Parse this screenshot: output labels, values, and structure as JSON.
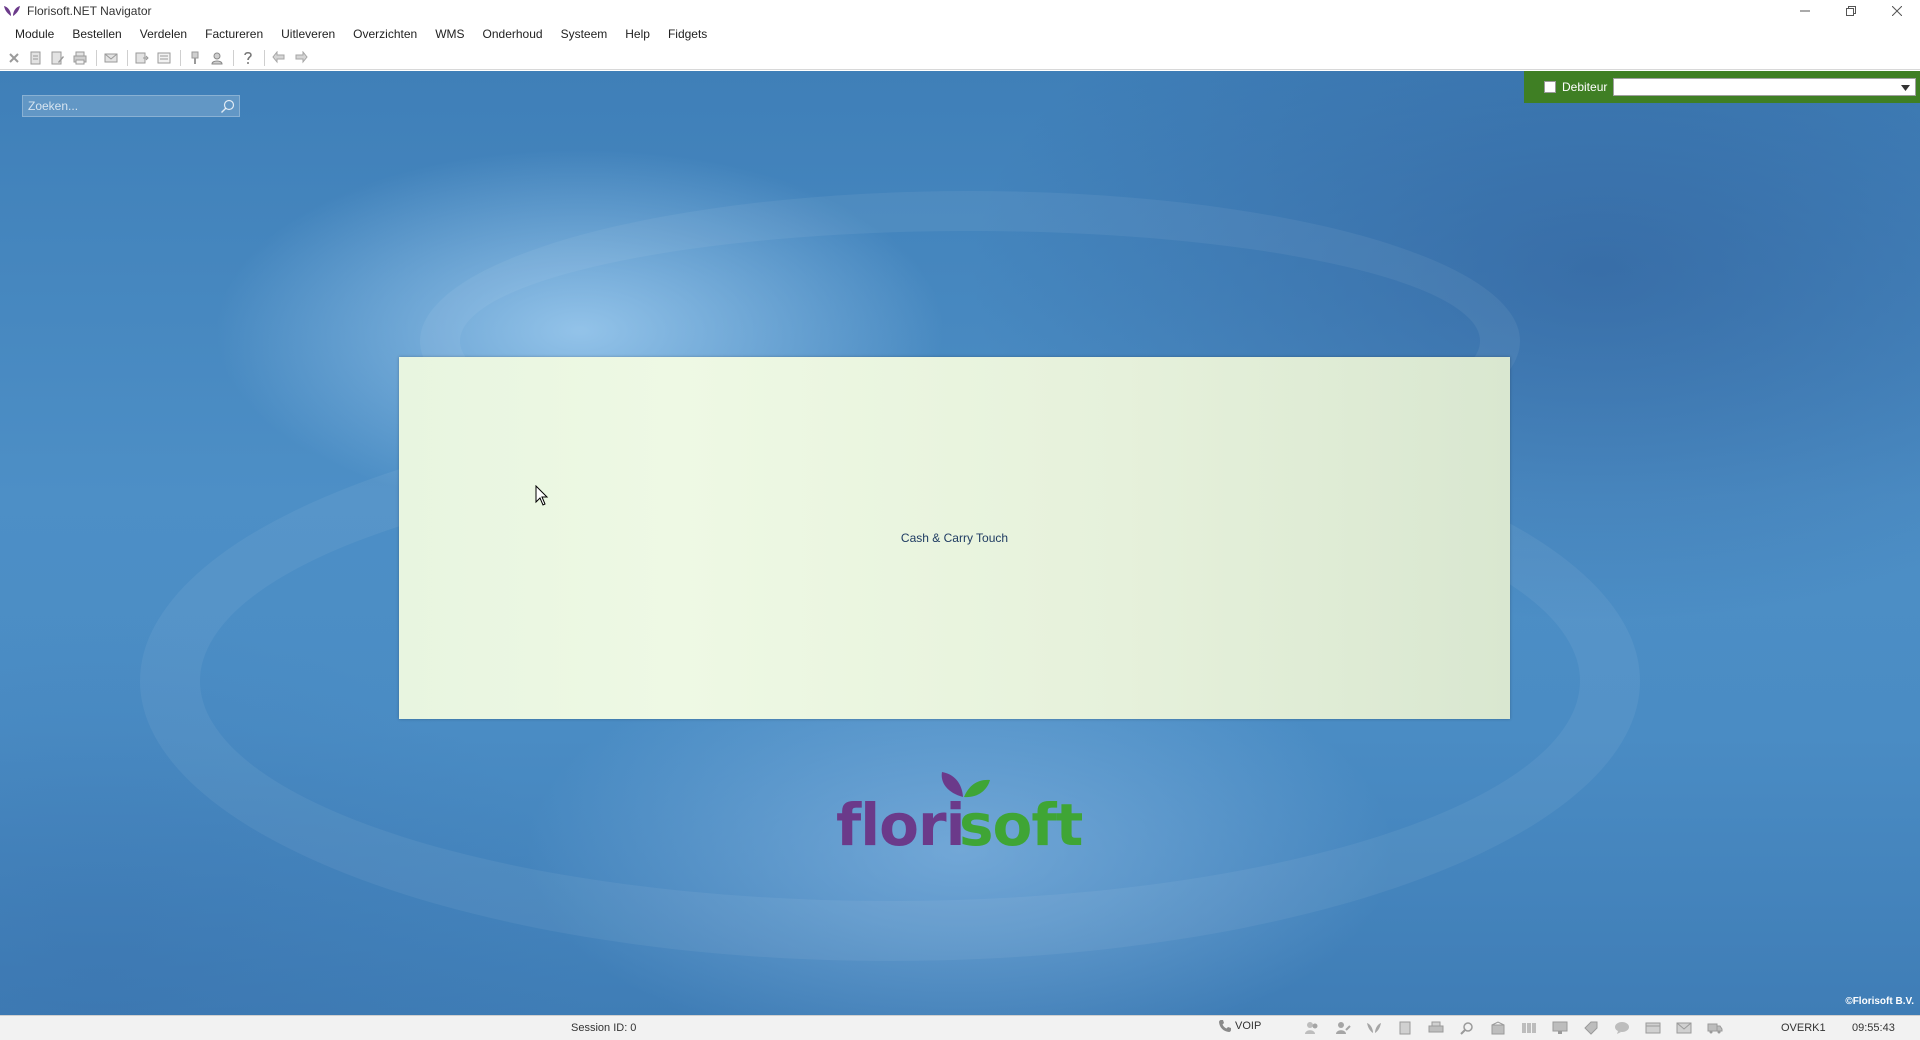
{
  "window": {
    "title": "Florisoft.NET Navigator",
    "controls": [
      "minimize",
      "restore",
      "close"
    ]
  },
  "menu": {
    "items": [
      "Module",
      "Bestellen",
      "Verdelen",
      "Factureren",
      "Uitleveren",
      "Overzichten",
      "WMS",
      "Onderhoud",
      "Systeem",
      "Help",
      "Fidgets"
    ]
  },
  "search": {
    "placeholder": "Zoeken..."
  },
  "debiteur": {
    "label": "Debiteur",
    "checked": false,
    "selected_value": ""
  },
  "tile": {
    "label": "Cash & Carry Touch"
  },
  "logo": {
    "text_part1": "flori",
    "text_part2": "soft",
    "color_purple": "#6b3a8a",
    "color_green": "#3fa535"
  },
  "copyright": "©Florisoft B.V.",
  "status": {
    "session": "Session ID: 0",
    "voip_label": "VOIP",
    "user": "OVERK1",
    "time": "09:55:43"
  },
  "colors": {
    "accent_green": "#3f7f24",
    "background_blue": "#4a8cc4",
    "tile_green": "#e8f5e0"
  }
}
